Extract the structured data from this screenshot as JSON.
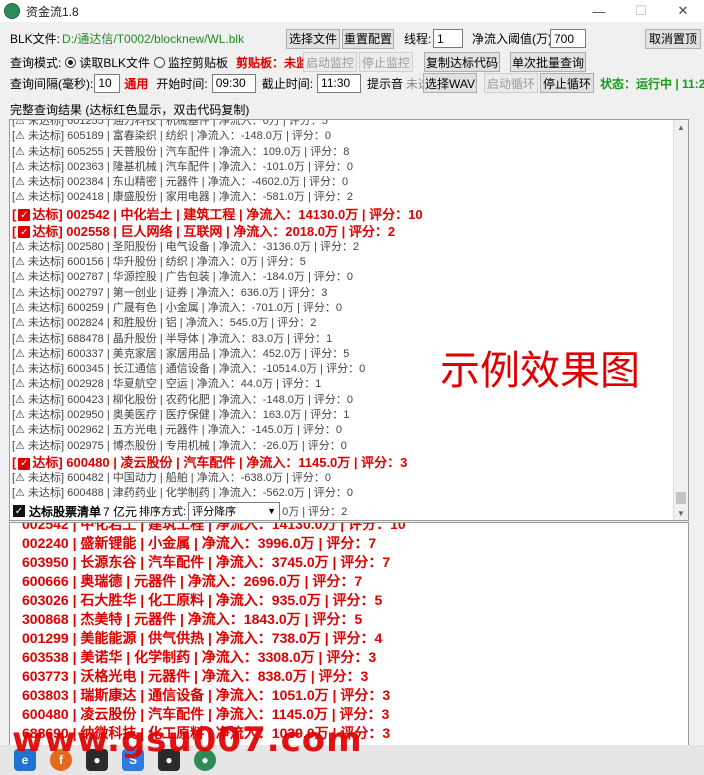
{
  "window": {
    "title": "资金流1.8"
  },
  "row1": {
    "blk_label": "BLK文件:",
    "blk_path": "D:/通达信/T0002/blocknew/WL.blk",
    "select_file": "选择文件",
    "reset_config": "重置配置",
    "threads_label": "线程:",
    "threads_value": "1",
    "inflow_label": "净流入阈值(万):",
    "inflow_value": "700",
    "cancel_top": "取消置顶"
  },
  "row2": {
    "mode_label": "查询模式:",
    "mode_blk": "读取BLK文件",
    "mode_clip": "监控剪贴板",
    "clip_label": "剪贴板：未监控",
    "start_monitor": "启动监控",
    "stop_monitor": "停止监控",
    "copy_codes": "复制达标代码",
    "batch_query": "单次批量查询"
  },
  "row3": {
    "interval_label": "查询间隔(毫秒):",
    "interval_value": "10",
    "apply": "通用",
    "start_label": "开始时间:",
    "start_value": "09:30",
    "end_label": "截止时间:",
    "end_value": "11:30",
    "sound_label": "提示音",
    "sound_state": "未选择",
    "select_wav": "选择WAV",
    "start_loop": "启动循环",
    "stop_loop": "停止循环",
    "status": "状态：运行中 | 11:29:5"
  },
  "result_header": "完整查询结果 (达标红色显示，双击代码复制)",
  "log": [
    {
      "hit": false,
      "text": "[⚠ 未达标] 601255 | 通力科技 | 机械基件 | 净流入：0万 | 评分：5"
    },
    {
      "hit": false,
      "text": "[⚠ 未达标] 605189 | 富春染织 | 纺织 | 净流入：-148.0万 | 评分：0"
    },
    {
      "hit": false,
      "text": "[⚠ 未达标] 605255 | 天普股份 | 汽车配件 | 净流入：109.0万 | 评分：8"
    },
    {
      "hit": false,
      "text": "[⚠ 未达标] 002363 | 隆基机械 | 汽车配件 | 净流入：-101.0万 | 评分：0"
    },
    {
      "hit": false,
      "text": "[⚠ 未达标] 002384 | 东山精密 | 元器件 | 净流入：-4602.0万 | 评分：0"
    },
    {
      "hit": false,
      "text": "[⚠ 未达标] 002418 | 康盛股份 | 家用电器 | 净流入：-581.0万 | 评分：2"
    },
    {
      "hit": true,
      "text": "达标] 002542 | 中化岩土 | 建筑工程 | 净流入：14130.0万 | 评分：10"
    },
    {
      "hit": true,
      "text": "达标] 002558 | 巨人网络 | 互联网 | 净流入：2018.0万 | 评分：2"
    },
    {
      "hit": false,
      "text": "[⚠ 未达标] 002580 | 圣阳股份 | 电气设备 | 净流入：-3136.0万 | 评分：2"
    },
    {
      "hit": false,
      "text": "[⚠ 未达标] 600156 | 华升股份 | 纺织 | 净流入：0万 | 评分：5"
    },
    {
      "hit": false,
      "text": "[⚠ 未达标] 002787 | 华源控股 | 广告包装 | 净流入：-184.0万 | 评分：0"
    },
    {
      "hit": false,
      "text": "[⚠ 未达标] 002797 | 第一创业 | 证券 | 净流入：636.0万 | 评分：3"
    },
    {
      "hit": false,
      "text": "[⚠ 未达标] 600259 | 广晟有色 | 小金属 | 净流入：-701.0万 | 评分：0"
    },
    {
      "hit": false,
      "text": "[⚠ 未达标] 002824 | 和胜股份 | 铝 | 净流入：545.0万 | 评分：2"
    },
    {
      "hit": false,
      "text": "[⚠ 未达标] 688478 | 晶升股份 | 半导体 | 净流入：83.0万 | 评分：1"
    },
    {
      "hit": false,
      "text": "[⚠ 未达标] 600337 | 美克家居 | 家居用品 | 净流入：452.0万 | 评分：5"
    },
    {
      "hit": false,
      "text": "[⚠ 未达标] 600345 | 长江通信 | 通信设备 | 净流入：-10514.0万 | 评分：0"
    },
    {
      "hit": false,
      "text": "[⚠ 未达标] 002928 | 华夏航空 | 空运 | 净流入：44.0万 | 评分：1"
    },
    {
      "hit": false,
      "text": "[⚠ 未达标] 600423 | 柳化股份 | 农药化肥 | 净流入：-148.0万 | 评分：0"
    },
    {
      "hit": false,
      "text": "[⚠ 未达标] 002950 | 奥美医疗 | 医疗保健 | 净流入：163.0万 | 评分：1"
    },
    {
      "hit": false,
      "text": "[⚠ 未达标] 002962 | 五方光电 | 元器件 | 净流入：-145.0万 | 评分：0"
    },
    {
      "hit": false,
      "text": "[⚠ 未达标] 002975 | 博杰股份 | 专用机械 | 净流入：-26.0万 | 评分：0"
    },
    {
      "hit": true,
      "text": "达标] 600480 | 凌云股份 | 汽车配件 | 净流入：1145.0万 | 评分：3"
    },
    {
      "hit": false,
      "text": "[⚠ 未达标] 600482 | 中国动力 | 船舶 | 净流入：-638.0万 | 评分：0"
    },
    {
      "hit": false,
      "text": "[⚠ 未达标] 600488 | 津药药业 | 化学制药 | 净流入：-562.0万 | 评分：0"
    },
    {
      "hit": true,
      "text": "达标] 688690 | 纳微科技 | 化工原料 | 净流入：1039.0万 | 评分：3"
    }
  ],
  "watermark_center": "示例效果图",
  "overlay_bar": {
    "checklist_label": "达标股票清单",
    "partial_text": "7 亿元",
    "sort_label": "排序方式:",
    "sort_value": "评分降序",
    "tail_text": "0万 | 评分：2"
  },
  "qualified": [
    "002542 | 中化岩土 | 建筑工程 | 净流入：14130.0万 | 评分：10",
    "002240 | 盛新锂能 | 小金属 | 净流入：3996.0万 | 评分：7",
    "603950 | 长源东谷 | 汽车配件 | 净流入：3745.0万 | 评分：7",
    "600666 | 奥瑞德 | 元器件 | 净流入：2696.0万 | 评分：7",
    "603026 | 石大胜华 | 化工原料 | 净流入：935.0万 | 评分：5",
    "300868 | 杰美特 | 元器件 | 净流入：1843.0万 | 评分：5",
    "001299 | 美能能源 | 供气供热 | 净流入：738.0万 | 评分：4",
    "603538 | 美诺华 | 化学制药 | 净流入：3308.0万 | 评分：3",
    "603773 | 沃格光电 | 元器件 | 净流入：838.0万 | 评分：3",
    "603803 | 瑞斯康达 | 通信设备 | 净流入：1051.0万 | 评分：3",
    "600480 | 凌云股份 | 汽车配件 | 净流入：1145.0万 | 评分：3",
    "688690 | 纳微科技 | 化工原料 | 净流入：1039.0万 | 评分：3"
  ],
  "watermark_bottom": "www.gsu007.com",
  "colors": {
    "hit_red": "#e00000",
    "status_green": "#1a9a1a",
    "path_green": "#228b22"
  }
}
